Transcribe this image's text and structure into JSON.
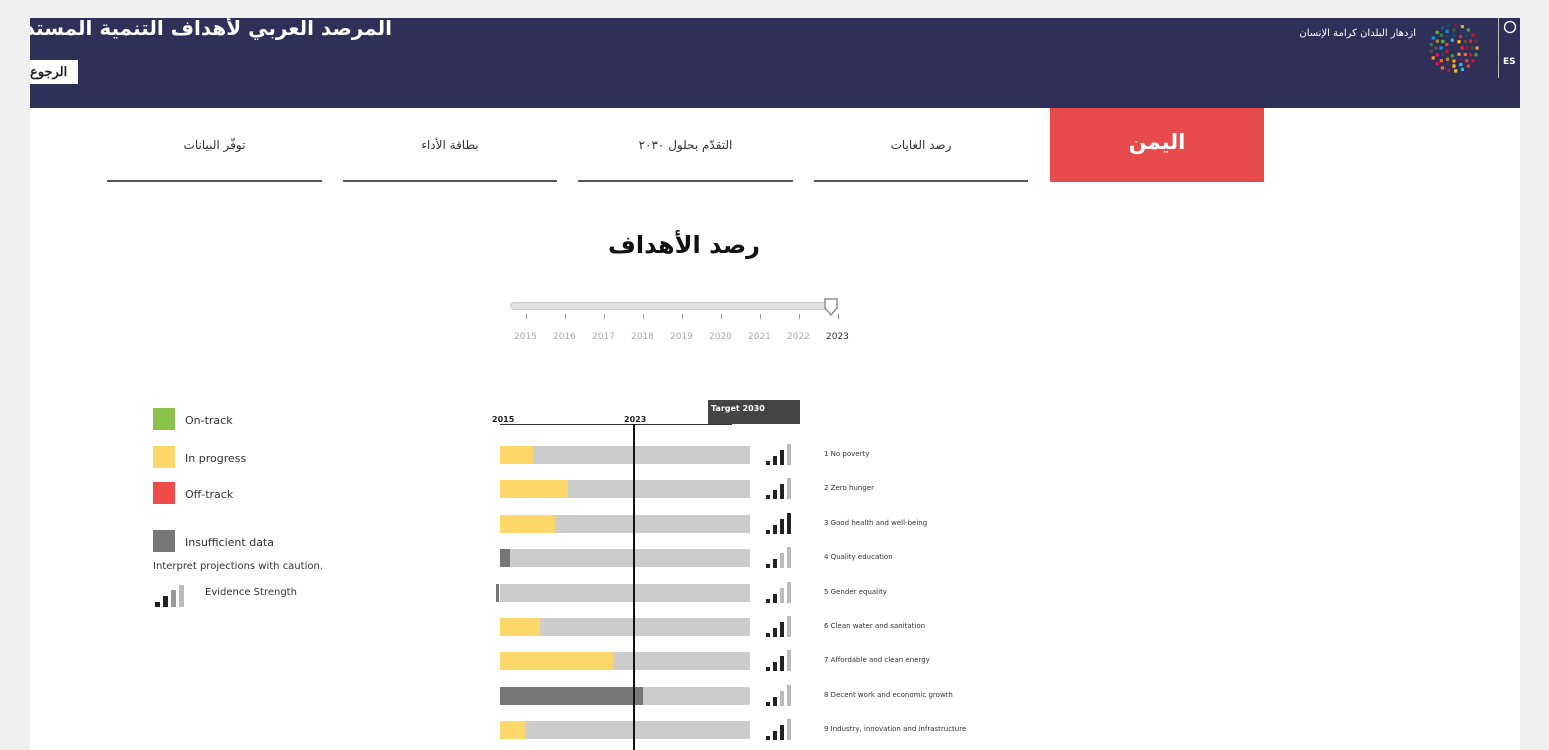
{
  "header": {
    "title": "المرصد العربي لأهداف التنمية المستدامة",
    "back_label": "الرجوع",
    "brand_tagline": "ازدهار البلدان كرامة الإنسان",
    "escwa_abbr": "ES"
  },
  "tabs": [
    {
      "label": "اليمن",
      "active": true
    },
    {
      "label": "رصد الغايات",
      "active": false
    },
    {
      "label": "التقدّم بحلول ٢٠٣٠",
      "active": false
    },
    {
      "label": "بطاقة الأداء",
      "active": false
    },
    {
      "label": "توفّر البيانات",
      "active": false
    }
  ],
  "section_title": "رصد الأهداف",
  "slider": {
    "years": [
      "2015",
      "2016",
      "2017",
      "2018",
      "2019",
      "2020",
      "2021",
      "2022",
      "2023"
    ],
    "selected": "2023"
  },
  "legend": {
    "on_track": "On-track",
    "in_progress": "In progress",
    "off_track": "Off-track",
    "insufficient": "Insufficient data",
    "caution_note": "Interpret projections with caution.",
    "evidence_strength": "Evidence Strength",
    "colors": {
      "on_track": "#8bc34a",
      "in_progress": "#fdd76a",
      "off_track": "#f04b4b",
      "insufficient": "#777777"
    }
  },
  "chart_data": {
    "type": "bar",
    "axis": {
      "start_label": "2015",
      "current_label": "2023",
      "target_label": "Target 2030"
    },
    "goals": [
      {
        "label": "1 No poverty",
        "status": "in_progress",
        "progress": 0.13,
        "evidence": 3
      },
      {
        "label": "2 Zero hunger",
        "status": "in_progress",
        "progress": 0.27,
        "evidence": 3
      },
      {
        "label": "3 Good health and well-being",
        "status": "in_progress",
        "progress": 0.22,
        "evidence": 4
      },
      {
        "label": "4 Quality education",
        "status": "insufficient",
        "progress": 0.04,
        "evidence": 2
      },
      {
        "label": "5 Gender equality",
        "status": "insufficient",
        "progress": 0.01,
        "evidence": 2
      },
      {
        "label": "6 Clean water and sanitation",
        "status": "in_progress",
        "progress": 0.16,
        "evidence": 3
      },
      {
        "label": "7 Affordable and clean energy",
        "status": "in_progress",
        "progress": 0.45,
        "evidence": 3
      },
      {
        "label": "8 Decent work and economic growth",
        "status": "insufficient",
        "progress": 0.57,
        "evidence": 2
      },
      {
        "label": "9 Industry, innovation and infrastructure",
        "status": "in_progress",
        "progress": 0.1,
        "evidence": 3
      }
    ]
  }
}
